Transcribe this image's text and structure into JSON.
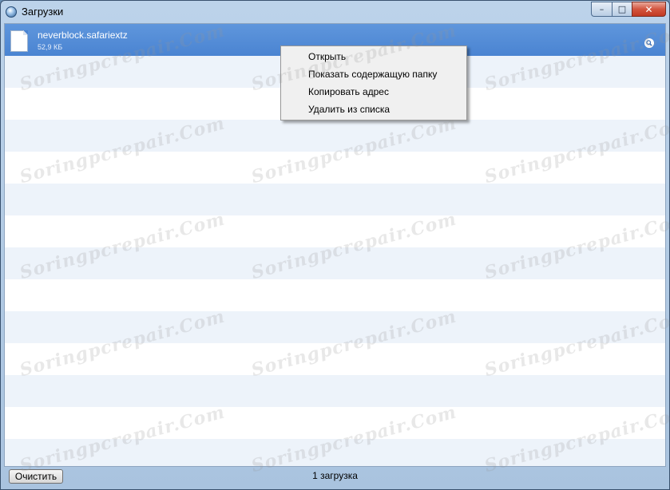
{
  "window": {
    "title": "Загрузки",
    "controls": {
      "minimize": "–",
      "maximize": "□",
      "close": "✕"
    }
  },
  "downloads": [
    {
      "name": "neverblock.safariextz",
      "size": "52,9 КБ",
      "action_icon": "magnifier-icon"
    }
  ],
  "context_menu": {
    "items": [
      {
        "label": "Открыть"
      },
      {
        "label": "Показать содержащую папку"
      },
      {
        "label": "Копировать адрес"
      },
      {
        "label": "Удалить из списка"
      }
    ]
  },
  "statusbar": {
    "clear_button": "Очистить",
    "count": "1 загрузка"
  },
  "watermark": "Soringpcrepair.Com",
  "colors": {
    "selected_row": "#4a84d2",
    "stripe": "#edf3fa",
    "close_button": "#c23a23"
  }
}
